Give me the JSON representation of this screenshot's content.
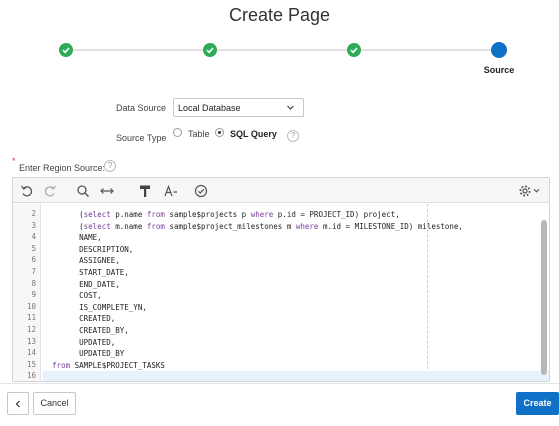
{
  "dialog": {
    "title": "Create Page"
  },
  "wizard": {
    "current_step_label": "Source"
  },
  "form": {
    "data_source_label": "Data Source",
    "data_source_value": "Local Database",
    "source_type_label": "Source Type",
    "option_table": "Table",
    "option_sql": "SQL Query",
    "required_marker": "*",
    "region_source_label": "Enter Region Source:",
    "help_glyph": "?"
  },
  "editor": {
    "lines": [
      {
        "n": "2",
        "parts": [
          [
            "",
            "        (select p.name from sample$projects p where p.id = PROJECT_ID) project,"
          ]
        ]
      },
      {
        "n": "3",
        "parts": [
          [
            "",
            "        (select m.name from sample$project_milestones m where m.id = MILESTONE_ID) milestone,"
          ]
        ]
      },
      {
        "n": "4",
        "parts": [
          [
            "",
            "        NAME,"
          ]
        ]
      },
      {
        "n": "5",
        "parts": [
          [
            "",
            "        DESCRIPTION,"
          ]
        ]
      },
      {
        "n": "6",
        "parts": [
          [
            "",
            "        ASSIGNEE,"
          ]
        ]
      },
      {
        "n": "7",
        "parts": [
          [
            "",
            "        START_DATE,"
          ]
        ]
      },
      {
        "n": "8",
        "parts": [
          [
            "",
            "        END_DATE,"
          ]
        ]
      },
      {
        "n": "9",
        "parts": [
          [
            "",
            "        COST,"
          ]
        ]
      },
      {
        "n": "10",
        "parts": [
          [
            "",
            "        IS_COMPLETE_YN,"
          ]
        ]
      },
      {
        "n": "11",
        "parts": [
          [
            "",
            "        CREATED,"
          ]
        ]
      },
      {
        "n": "12",
        "parts": [
          [
            "",
            "        CREATED_BY,"
          ]
        ]
      },
      {
        "n": "13",
        "parts": [
          [
            "",
            "        UPDATED,"
          ]
        ]
      },
      {
        "n": "14",
        "parts": [
          [
            "",
            "        UPDATED_BY"
          ]
        ]
      },
      {
        "n": "15",
        "parts": [
          [
            "",
            "  from SAMPLE$PROJECT_TASKS"
          ]
        ]
      },
      {
        "n": "16",
        "parts": [
          [
            "",
            ""
          ]
        ]
      }
    ],
    "active_line": "16"
  },
  "footer": {
    "cancel_label": "Cancel",
    "create_label": "Create"
  },
  "colors": {
    "accent": "#0f70c7",
    "complete": "#2eab55",
    "keyword": "#7a3e9d"
  },
  "icons": [
    "check-icon",
    "chevron-down-icon",
    "undo-icon",
    "redo-icon",
    "search-icon",
    "replace-icon",
    "hammer-icon",
    "font-size-icon",
    "validate-icon",
    "gear-icon",
    "chevron-left-icon"
  ]
}
